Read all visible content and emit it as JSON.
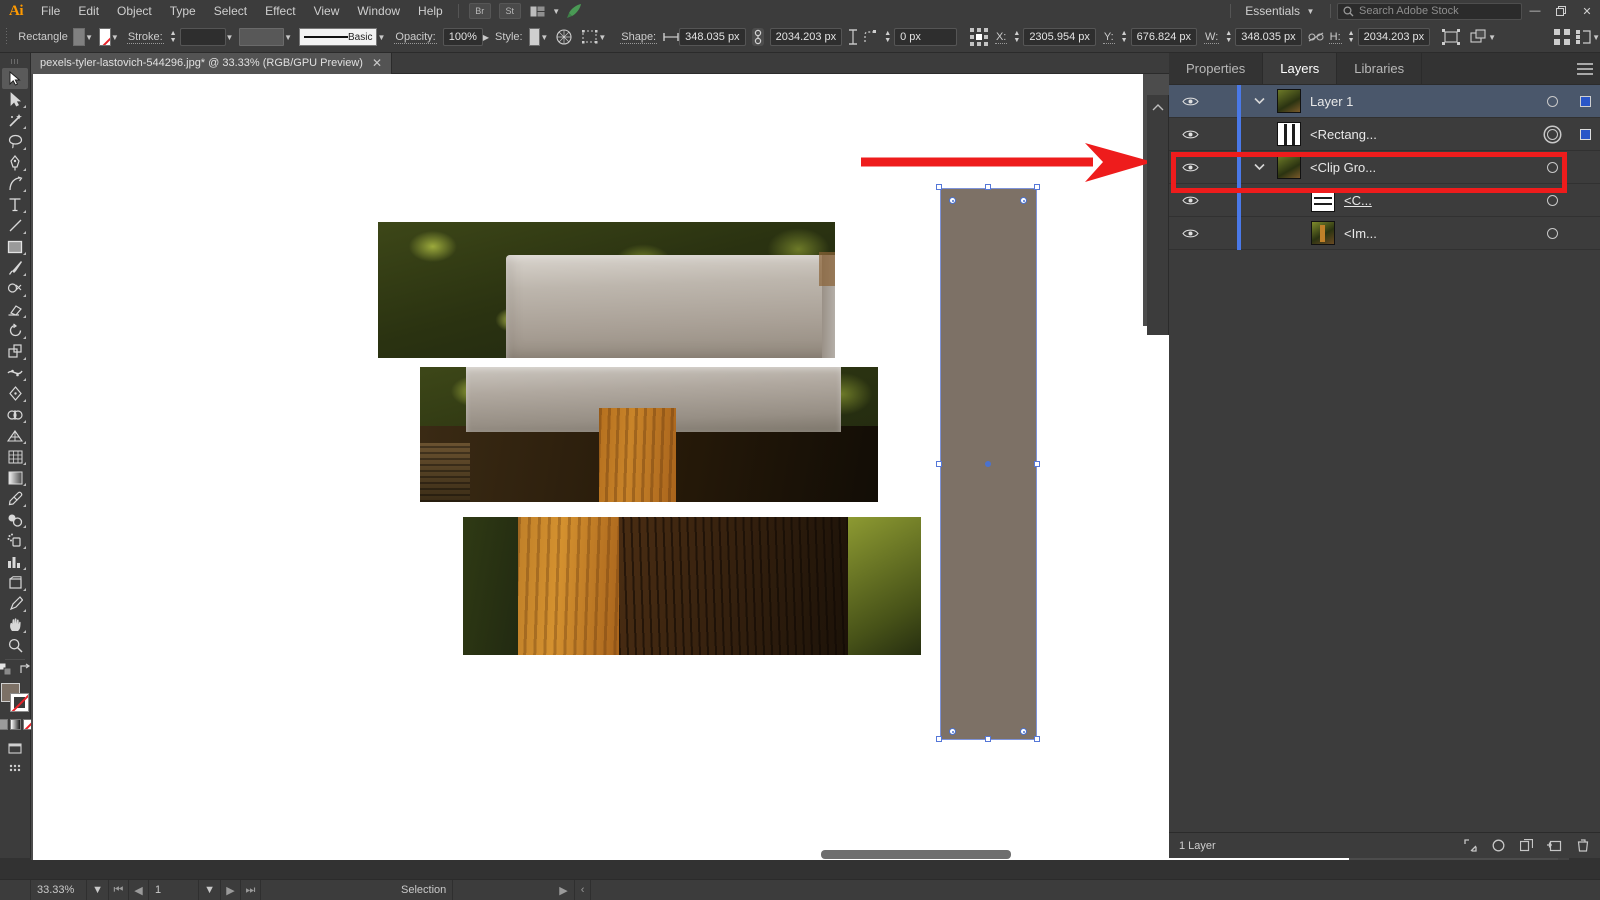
{
  "app": {
    "name": "Adobe Illustrator",
    "logo": "Ai"
  },
  "menubar": {
    "items": [
      "File",
      "Edit",
      "Object",
      "Type",
      "Select",
      "Effect",
      "View",
      "Window",
      "Help"
    ],
    "bridge_label": "Br",
    "stock_label": "St",
    "arrange_icon": "arrange-documents-icon",
    "rocket_icon": "discover-rocket-icon",
    "workspace": "Essentials",
    "search_placeholder": "Search Adobe Stock",
    "window_controls": {
      "minimize": "—",
      "restore": "❐",
      "close": "✕"
    }
  },
  "controlbar": {
    "object_type": "Rectangle",
    "fill_color": "#808080",
    "stroke_label": "Stroke:",
    "stroke_weight": "",
    "stroke_profile": "",
    "stroke_definition": "Basic",
    "opacity_label": "Opacity:",
    "opacity_value": "100%",
    "style_label": "Style:",
    "shape_label": "Shape:",
    "shape_width": "348.035 px",
    "shape_height": "2034.203 px",
    "corner_radius": "0 px",
    "x_label": "X:",
    "x_value": "2305.954 px",
    "y_label": "Y:",
    "y_value": "676.824 px",
    "w_label": "W:",
    "w_value": "348.035 px",
    "h_label": "H:",
    "h_value": "2034.203 px"
  },
  "toolbar": {
    "tools": [
      {
        "name": "selection-tool",
        "glyph": "sel",
        "active": true
      },
      {
        "name": "direct-selection-tool",
        "glyph": "dsel"
      },
      {
        "name": "magic-wand-tool",
        "glyph": "wand"
      },
      {
        "name": "lasso-tool",
        "glyph": "lasso"
      },
      {
        "name": "pen-tool",
        "glyph": "pen"
      },
      {
        "name": "curvature-tool",
        "glyph": "curv"
      },
      {
        "name": "type-tool",
        "glyph": "type"
      },
      {
        "name": "line-segment-tool",
        "glyph": "line"
      },
      {
        "name": "rectangle-tool",
        "glyph": "rect"
      },
      {
        "name": "paintbrush-tool",
        "glyph": "brush"
      },
      {
        "name": "shaper-tool",
        "glyph": "shaper"
      },
      {
        "name": "eraser-tool",
        "glyph": "eraser"
      },
      {
        "name": "rotate-tool",
        "glyph": "rotate"
      },
      {
        "name": "scale-tool",
        "glyph": "scale"
      },
      {
        "name": "width-tool",
        "glyph": "width"
      },
      {
        "name": "free-transform-tool",
        "glyph": "freet"
      },
      {
        "name": "shape-builder-tool",
        "glyph": "shapeb"
      },
      {
        "name": "perspective-grid-tool",
        "glyph": "persp"
      },
      {
        "name": "mesh-tool",
        "glyph": "mesh"
      },
      {
        "name": "gradient-tool",
        "glyph": "grad"
      },
      {
        "name": "eyedropper-tool",
        "glyph": "eyedrop"
      },
      {
        "name": "blend-tool",
        "glyph": "blend"
      },
      {
        "name": "symbol-sprayer-tool",
        "glyph": "symbol"
      },
      {
        "name": "column-graph-tool",
        "glyph": "graph"
      },
      {
        "name": "artboard-tool",
        "glyph": "artboard"
      },
      {
        "name": "slice-tool",
        "glyph": "slice"
      },
      {
        "name": "hand-tool",
        "glyph": "hand"
      },
      {
        "name": "zoom-tool",
        "glyph": "zoom"
      }
    ],
    "fill_color": "#7d7166",
    "stroke_color": "none",
    "edit_toolbar_label": "edit-toolbar-icon"
  },
  "document": {
    "tab_title": "pexels-tyler-lastovich-544296.jpg* @ 33.33% (RGB/GPU Preview)",
    "close_icon": "✕"
  },
  "canvas": {
    "strips": [
      {
        "name": "image-strip-blade-top",
        "content": "axe blade on moss"
      },
      {
        "name": "image-strip-blade-handle",
        "content": "axe blade and wooden handle"
      },
      {
        "name": "image-strip-stump",
        "content": "wooden handle and stump"
      }
    ],
    "selected_object": {
      "name": "rectangle-shape",
      "fill": "#7d7166",
      "selection_color": "#4a72d0"
    },
    "annotation": {
      "name": "red-arrow-annotation",
      "color": "#ee1c1c"
    }
  },
  "panels": {
    "tabs": [
      {
        "label": "Properties",
        "active": false
      },
      {
        "label": "Layers",
        "active": true
      },
      {
        "label": "Libraries",
        "active": false
      }
    ],
    "menu_icon": "panel-menu-icon",
    "layers": [
      {
        "name": "Layer 1",
        "indent": 0,
        "twisty": true,
        "selected": true,
        "thumb": "moss",
        "target": "ring",
        "color": "#2a56c8",
        "showcolor": true,
        "underline": false
      },
      {
        "name": "<Rectang...",
        "indent": 1,
        "twisty": false,
        "selected": false,
        "thumb": "rect",
        "target": "dbl",
        "color": "#2a56c8",
        "showcolor": true,
        "underline": false,
        "highlighted": true
      },
      {
        "name": "<Clip Gro...",
        "indent": 1,
        "twisty": true,
        "selected": false,
        "thumb": "moss",
        "target": "ring",
        "color": "",
        "showcolor": false,
        "underline": false
      },
      {
        "name": "<C...",
        "indent": 2,
        "twisty": false,
        "selected": false,
        "thumb": "clip",
        "target": "ring",
        "color": "",
        "showcolor": false,
        "underline": true
      },
      {
        "name": "<Im...",
        "indent": 2,
        "twisty": false,
        "selected": false,
        "thumb": "img",
        "target": "ring",
        "color": "",
        "showcolor": false,
        "underline": false
      }
    ],
    "footer": {
      "count_label": "1 Layer",
      "icons": [
        "locate-object-icon",
        "make-clipping-mask-icon",
        "create-new-sublayer-icon",
        "create-new-layer-icon",
        "delete-selection-icon"
      ]
    }
  },
  "statusbar": {
    "zoom": "33.33%",
    "page": "1",
    "status_text": "Selection"
  }
}
